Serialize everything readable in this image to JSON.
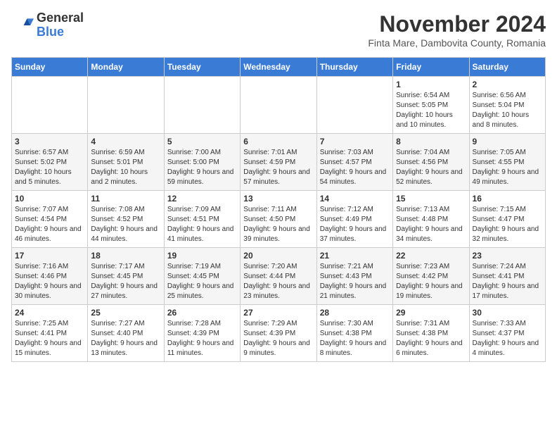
{
  "header": {
    "logo_general": "General",
    "logo_blue": "Blue",
    "month_title": "November 2024",
    "subtitle": "Finta Mare, Dambovita County, Romania"
  },
  "weekdays": [
    "Sunday",
    "Monday",
    "Tuesday",
    "Wednesday",
    "Thursday",
    "Friday",
    "Saturday"
  ],
  "weeks": [
    [
      {
        "day": "",
        "info": ""
      },
      {
        "day": "",
        "info": ""
      },
      {
        "day": "",
        "info": ""
      },
      {
        "day": "",
        "info": ""
      },
      {
        "day": "",
        "info": ""
      },
      {
        "day": "1",
        "info": "Sunrise: 6:54 AM\nSunset: 5:05 PM\nDaylight: 10 hours and 10 minutes."
      },
      {
        "day": "2",
        "info": "Sunrise: 6:56 AM\nSunset: 5:04 PM\nDaylight: 10 hours and 8 minutes."
      }
    ],
    [
      {
        "day": "3",
        "info": "Sunrise: 6:57 AM\nSunset: 5:02 PM\nDaylight: 10 hours and 5 minutes."
      },
      {
        "day": "4",
        "info": "Sunrise: 6:59 AM\nSunset: 5:01 PM\nDaylight: 10 hours and 2 minutes."
      },
      {
        "day": "5",
        "info": "Sunrise: 7:00 AM\nSunset: 5:00 PM\nDaylight: 9 hours and 59 minutes."
      },
      {
        "day": "6",
        "info": "Sunrise: 7:01 AM\nSunset: 4:59 PM\nDaylight: 9 hours and 57 minutes."
      },
      {
        "day": "7",
        "info": "Sunrise: 7:03 AM\nSunset: 4:57 PM\nDaylight: 9 hours and 54 minutes."
      },
      {
        "day": "8",
        "info": "Sunrise: 7:04 AM\nSunset: 4:56 PM\nDaylight: 9 hours and 52 minutes."
      },
      {
        "day": "9",
        "info": "Sunrise: 7:05 AM\nSunset: 4:55 PM\nDaylight: 9 hours and 49 minutes."
      }
    ],
    [
      {
        "day": "10",
        "info": "Sunrise: 7:07 AM\nSunset: 4:54 PM\nDaylight: 9 hours and 46 minutes."
      },
      {
        "day": "11",
        "info": "Sunrise: 7:08 AM\nSunset: 4:52 PM\nDaylight: 9 hours and 44 minutes."
      },
      {
        "day": "12",
        "info": "Sunrise: 7:09 AM\nSunset: 4:51 PM\nDaylight: 9 hours and 41 minutes."
      },
      {
        "day": "13",
        "info": "Sunrise: 7:11 AM\nSunset: 4:50 PM\nDaylight: 9 hours and 39 minutes."
      },
      {
        "day": "14",
        "info": "Sunrise: 7:12 AM\nSunset: 4:49 PM\nDaylight: 9 hours and 37 minutes."
      },
      {
        "day": "15",
        "info": "Sunrise: 7:13 AM\nSunset: 4:48 PM\nDaylight: 9 hours and 34 minutes."
      },
      {
        "day": "16",
        "info": "Sunrise: 7:15 AM\nSunset: 4:47 PM\nDaylight: 9 hours and 32 minutes."
      }
    ],
    [
      {
        "day": "17",
        "info": "Sunrise: 7:16 AM\nSunset: 4:46 PM\nDaylight: 9 hours and 30 minutes."
      },
      {
        "day": "18",
        "info": "Sunrise: 7:17 AM\nSunset: 4:45 PM\nDaylight: 9 hours and 27 minutes."
      },
      {
        "day": "19",
        "info": "Sunrise: 7:19 AM\nSunset: 4:45 PM\nDaylight: 9 hours and 25 minutes."
      },
      {
        "day": "20",
        "info": "Sunrise: 7:20 AM\nSunset: 4:44 PM\nDaylight: 9 hours and 23 minutes."
      },
      {
        "day": "21",
        "info": "Sunrise: 7:21 AM\nSunset: 4:43 PM\nDaylight: 9 hours and 21 minutes."
      },
      {
        "day": "22",
        "info": "Sunrise: 7:23 AM\nSunset: 4:42 PM\nDaylight: 9 hours and 19 minutes."
      },
      {
        "day": "23",
        "info": "Sunrise: 7:24 AM\nSunset: 4:41 PM\nDaylight: 9 hours and 17 minutes."
      }
    ],
    [
      {
        "day": "24",
        "info": "Sunrise: 7:25 AM\nSunset: 4:41 PM\nDaylight: 9 hours and 15 minutes."
      },
      {
        "day": "25",
        "info": "Sunrise: 7:27 AM\nSunset: 4:40 PM\nDaylight: 9 hours and 13 minutes."
      },
      {
        "day": "26",
        "info": "Sunrise: 7:28 AM\nSunset: 4:39 PM\nDaylight: 9 hours and 11 minutes."
      },
      {
        "day": "27",
        "info": "Sunrise: 7:29 AM\nSunset: 4:39 PM\nDaylight: 9 hours and 9 minutes."
      },
      {
        "day": "28",
        "info": "Sunrise: 7:30 AM\nSunset: 4:38 PM\nDaylight: 9 hours and 8 minutes."
      },
      {
        "day": "29",
        "info": "Sunrise: 7:31 AM\nSunset: 4:38 PM\nDaylight: 9 hours and 6 minutes."
      },
      {
        "day": "30",
        "info": "Sunrise: 7:33 AM\nSunset: 4:37 PM\nDaylight: 9 hours and 4 minutes."
      }
    ]
  ]
}
